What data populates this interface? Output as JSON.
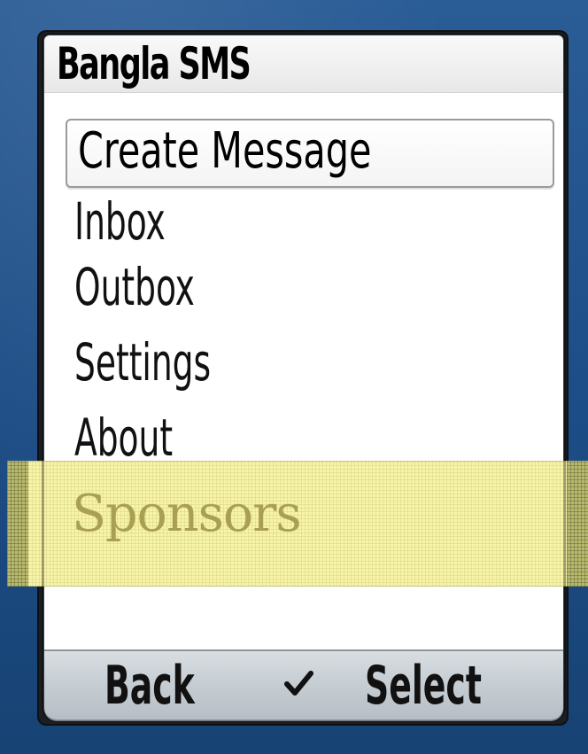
{
  "app": {
    "title": "Bangla SMS"
  },
  "menu": {
    "selected_item": "Create Message",
    "items": [
      "Inbox",
      "Outbox",
      "Settings",
      "About"
    ]
  },
  "ad": {
    "label": "Sponsors"
  },
  "softkeys": {
    "left": "Back",
    "right": "Select",
    "center_icon": "checkmark-icon"
  },
  "colors": {
    "background": "#1e4f87",
    "ad_fill": "#f7f3a7",
    "ad_text": "#a59c4f",
    "softkey_bar": "#c6cdd2"
  }
}
